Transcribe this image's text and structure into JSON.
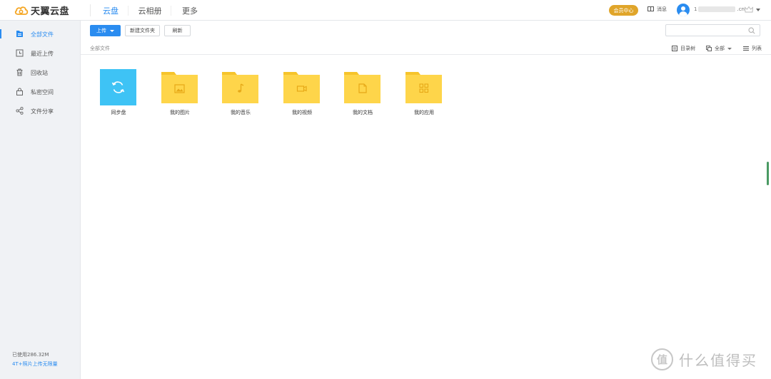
{
  "brand": {
    "logo_text": "天翼云盘"
  },
  "nav": {
    "items": [
      {
        "label": "云盘"
      },
      {
        "label": "云相册"
      },
      {
        "label": "更多"
      }
    ]
  },
  "header": {
    "vip_label": "会员中心",
    "message_label": "消息",
    "account_prefix": "1",
    "account_suffix": ".cn"
  },
  "sidebar": {
    "items": [
      {
        "label": "全部文件",
        "icon": "file-folder-icon"
      },
      {
        "label": "最近上传",
        "icon": "clock-icon"
      },
      {
        "label": "回收站",
        "icon": "trash-icon"
      },
      {
        "label": "私密空间",
        "icon": "lock-icon"
      },
      {
        "label": "文件分享",
        "icon": "share-icon"
      }
    ],
    "storage_text": "已使用286.32M",
    "promo_text": "4T+照片上传无限量"
  },
  "toolbar": {
    "upload_label": "上传",
    "new_folder_label": "新建文件夹",
    "refresh_label": "刷新",
    "search_placeholder": ""
  },
  "breadcrumb": {
    "text": "全部文件"
  },
  "view_options": {
    "tree_label": "目录树",
    "filter_label": "全部",
    "list_label": "列表"
  },
  "files": [
    {
      "name": "同步盘",
      "icon": "sync-icon"
    },
    {
      "name": "我的图片",
      "icon": "image-icon"
    },
    {
      "name": "我的音乐",
      "icon": "music-note-icon"
    },
    {
      "name": "我的视频",
      "icon": "video-icon"
    },
    {
      "name": "我的文档",
      "icon": "document-icon"
    },
    {
      "name": "我的应用",
      "icon": "apps-grid-icon"
    }
  ],
  "watermark": {
    "badge": "值",
    "text": "什么值得买"
  },
  "colors": {
    "accent": "#2a8cf0",
    "folder": "#fed54a",
    "folder_tab": "#f6c42b",
    "sync": "#3ec3f5",
    "vip": "#e0a52a"
  }
}
